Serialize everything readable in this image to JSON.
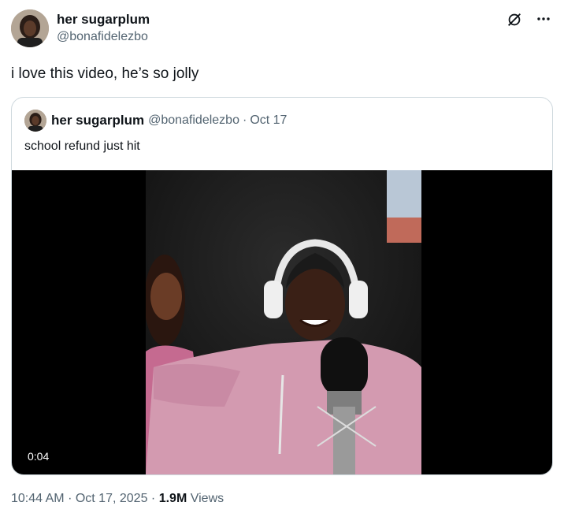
{
  "post": {
    "display_name": "her sugarplum",
    "handle": "@bonafidelezbo",
    "text": "i love this video, he’s so jolly",
    "avatar_icon": "avatar-photo",
    "grok_icon": "grok-icon",
    "more_icon": "more-options-icon"
  },
  "quote": {
    "display_name": "her sugarplum",
    "handle": "@bonafidelezbo",
    "separator": "·",
    "date": "Oct 17",
    "text": "school refund just hit",
    "video_duration": "0:04"
  },
  "footer": {
    "time": "10:44 AM",
    "sep1": "·",
    "date": "Oct 17, 2025",
    "sep2": "·",
    "views_count": "1.9M",
    "views_label": "Views"
  },
  "colors": {
    "text_primary": "#0f1419",
    "text_secondary": "#536471",
    "border": "#cfd9de"
  }
}
